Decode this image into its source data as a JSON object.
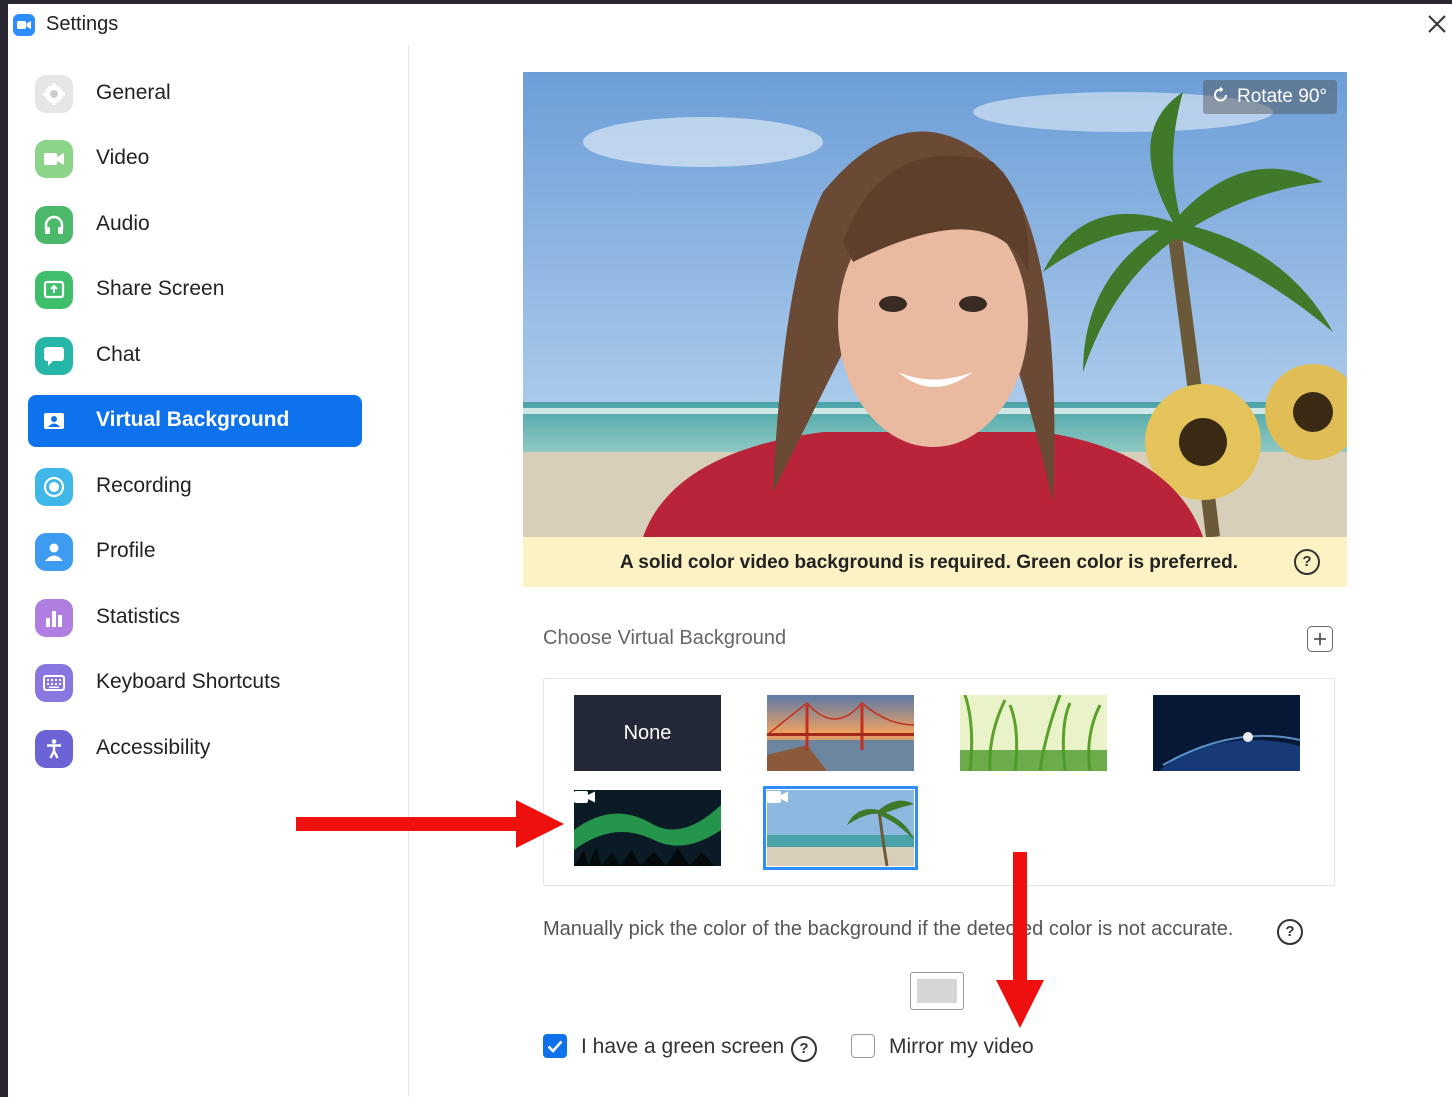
{
  "window": {
    "title": "Settings"
  },
  "sidebar": {
    "items": [
      {
        "label": "General",
        "icon": "gear-icon",
        "color": "#e8e8e8"
      },
      {
        "label": "Video",
        "icon": "video-camera-icon",
        "color": "#8cd48a"
      },
      {
        "label": "Audio",
        "icon": "headphones-icon",
        "color": "#4cb96a"
      },
      {
        "label": "Share Screen",
        "icon": "share-screen-icon",
        "color": "#3fbf6c"
      },
      {
        "label": "Chat",
        "icon": "chat-bubble-icon",
        "color": "#26b6a8"
      },
      {
        "label": "Virtual Background",
        "icon": "virtual-background-icon",
        "color": "#0e72ed",
        "active": true
      },
      {
        "label": "Recording",
        "icon": "record-icon",
        "color": "#3fb7e8"
      },
      {
        "label": "Profile",
        "icon": "profile-icon",
        "color": "#3d9cf0"
      },
      {
        "label": "Statistics",
        "icon": "bar-chart-icon",
        "color": "#b07de0"
      },
      {
        "label": "Keyboard Shortcuts",
        "icon": "keyboard-icon",
        "color": "#8a76e0"
      },
      {
        "label": "Accessibility",
        "icon": "accessibility-icon",
        "color": "#6b63d6"
      }
    ]
  },
  "preview": {
    "rotate_label": "Rotate 90°",
    "warning": "A solid color video background is required. Green color is preferred."
  },
  "backgrounds": {
    "section_label": "Choose Virtual Background",
    "none_label": "None",
    "items": [
      {
        "name": "None"
      },
      {
        "name": "golden-gate-bridge"
      },
      {
        "name": "grass"
      },
      {
        "name": "earth-from-space"
      },
      {
        "name": "aurora",
        "video": true
      },
      {
        "name": "beach-palm",
        "video": true,
        "selected": true
      }
    ]
  },
  "manual_pick": {
    "text": "Manually pick the color of the background if the detected color is not accurate.",
    "swatch_color": "#d6d6d6"
  },
  "options": {
    "green_screen_label": "I have a green screen",
    "green_screen_checked": true,
    "mirror_label": "Mirror my video",
    "mirror_checked": false
  },
  "colors": {
    "accent": "#0e72ed",
    "annotation_arrow": "#ee0f0f",
    "warning_bg": "#fdf2c4"
  }
}
